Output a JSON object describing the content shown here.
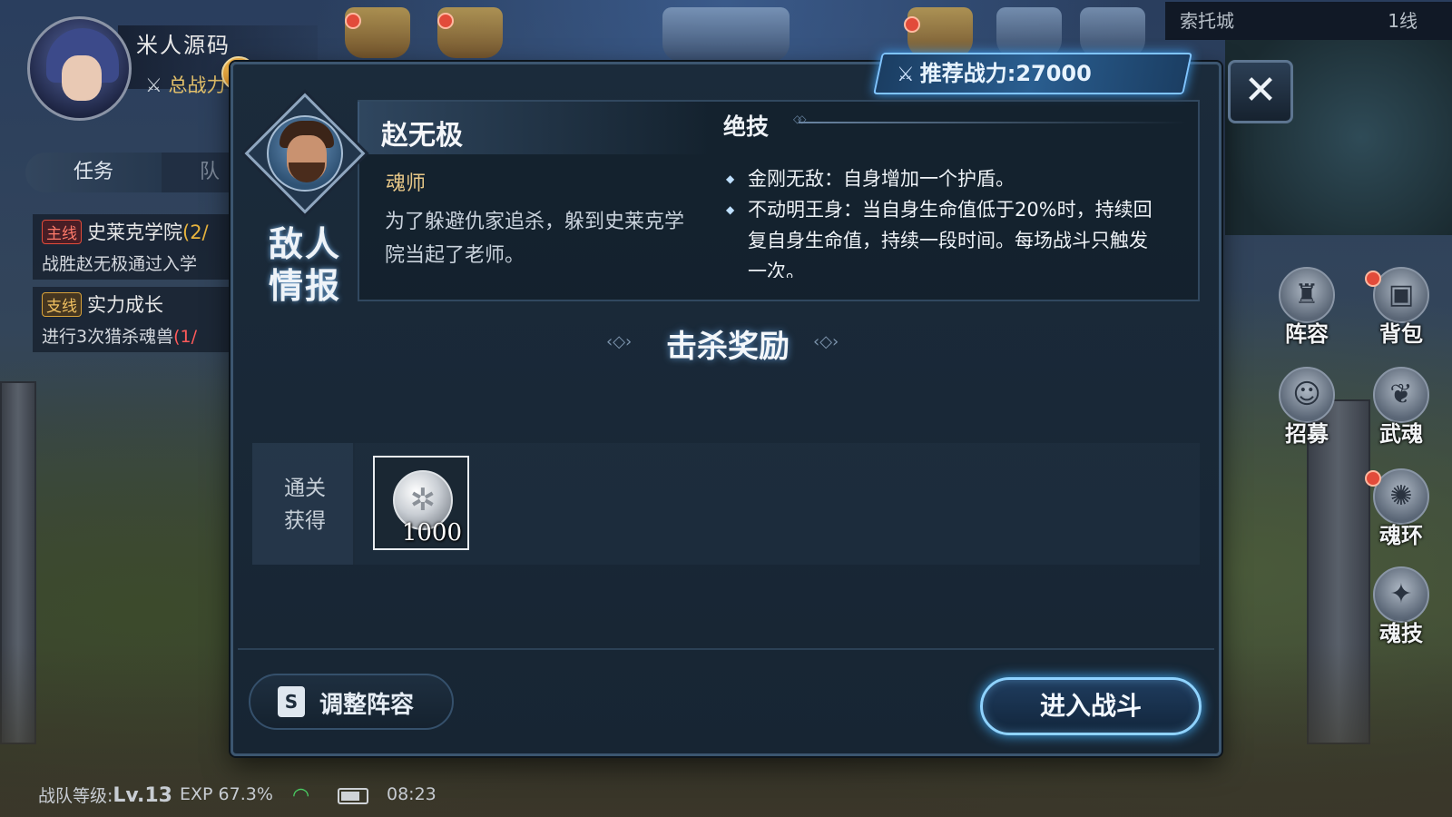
{
  "player": {
    "name": "米人源码",
    "power_label": "总战力"
  },
  "quests": {
    "tab_task": "任务",
    "tab_team": "队",
    "main": {
      "tag": "主线",
      "title": "史莱克学院",
      "progress": "(2/",
      "desc": "战胜赵无极通过入学"
    },
    "side": {
      "tag": "支线",
      "title": "实力成长",
      "desc": "进行3次猎杀魂兽",
      "progress": "(1/"
    }
  },
  "location": {
    "city": "索托城",
    "line": "1线"
  },
  "side_menu": [
    {
      "label": "阵容",
      "icon": "formation-icon"
    },
    {
      "label": "背包",
      "icon": "backpack-icon"
    },
    {
      "label": "招募",
      "icon": "recruit-icon"
    },
    {
      "label": "武魂",
      "icon": "martial-soul-icon"
    },
    {
      "label": "魂环",
      "icon": "soul-ring-icon"
    },
    {
      "label": "魂技",
      "icon": "soul-skill-icon"
    }
  ],
  "status": {
    "team_level_label": "战队等级:",
    "team_level_value": "Lv.13",
    "exp": "EXP 67.3%",
    "time": "08:23"
  },
  "dialog": {
    "recommended_power": "推荐战力:27000",
    "enemy_info_label": "敌人情报",
    "enemy_name": "赵无极",
    "enemy_class": "魂师",
    "enemy_desc": "为了躲避仇家追杀，躲到史莱克学院当起了老师。",
    "skill_title": "绝技",
    "skills": [
      "金刚无敌：自身增加一个护盾。",
      "不动明王身：当自身生命值低于20%时，持续回复自身生命值，持续一段时间。每场战斗只触发一次。"
    ],
    "reward_title": "击杀奖励",
    "reward_row_label": "通关获得",
    "rewards": [
      {
        "icon": "silver-coin-icon",
        "count": "1000"
      }
    ],
    "adjust_button": "调整阵容",
    "enter_button": "进入战斗",
    "close_symbol": "✕"
  },
  "colors": {
    "accent_blue": "#8fd3ff",
    "gold": "#e8c888",
    "panel_bg": "#1b2b3b"
  }
}
